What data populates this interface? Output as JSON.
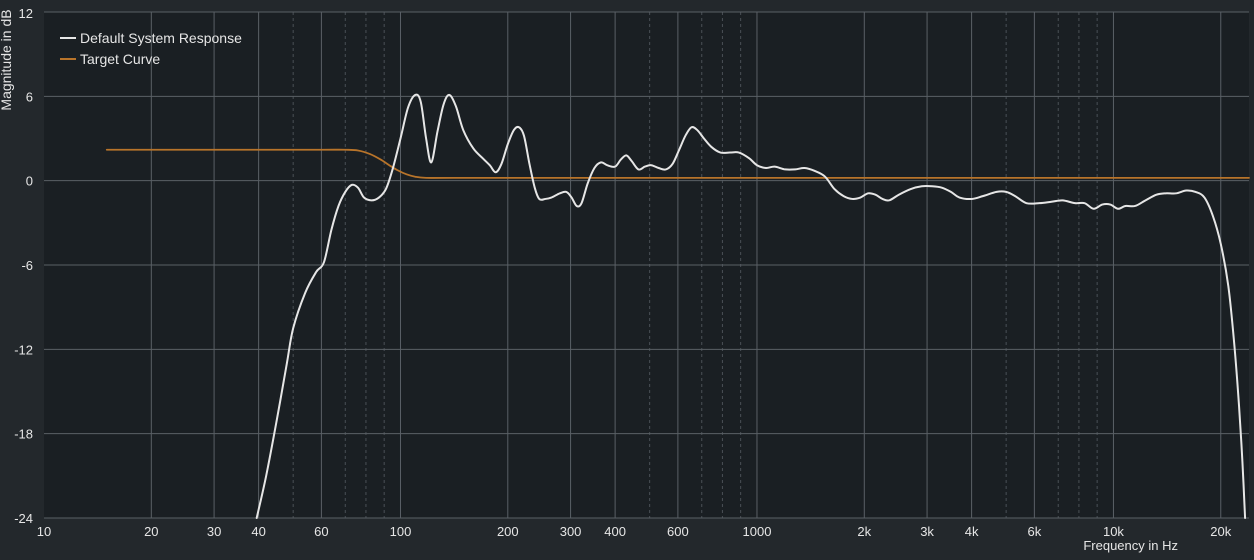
{
  "chart_data": {
    "type": "line",
    "xlabel": "Frequency in Hz",
    "ylabel": "Magnitude in dB",
    "x_scale": "log",
    "xlim": [
      10,
      24000
    ],
    "ylim": [
      -24,
      12
    ],
    "grid": true,
    "legend_position": "top-left",
    "x_ticks": [
      {
        "value": 10,
        "label": "10"
      },
      {
        "value": 20,
        "label": "20"
      },
      {
        "value": 30,
        "label": "30"
      },
      {
        "value": 40,
        "label": "40"
      },
      {
        "value": 60,
        "label": "60"
      },
      {
        "value": 100,
        "label": "100"
      },
      {
        "value": 200,
        "label": "200"
      },
      {
        "value": 300,
        "label": "300"
      },
      {
        "value": 400,
        "label": "400"
      },
      {
        "value": 600,
        "label": "600"
      },
      {
        "value": 1000,
        "label": "1000"
      },
      {
        "value": 2000,
        "label": "2k"
      },
      {
        "value": 3000,
        "label": "3k"
      },
      {
        "value": 4000,
        "label": "4k"
      },
      {
        "value": 6000,
        "label": "6k"
      },
      {
        "value": 10000,
        "label": "10k"
      },
      {
        "value": 20000,
        "label": "20k"
      }
    ],
    "y_ticks": [
      {
        "value": 12,
        "label": "12"
      },
      {
        "value": 6,
        "label": "6"
      },
      {
        "value": 0,
        "label": "0"
      },
      {
        "value": -6,
        "label": "-6"
      },
      {
        "value": -12,
        "label": "-12"
      },
      {
        "value": -18,
        "label": "-18"
      },
      {
        "value": -24,
        "label": "-24"
      }
    ],
    "series": [
      {
        "name": "Default System Response",
        "color": "#e6e6e6",
        "points": [
          [
            39.5,
            -24
          ],
          [
            42,
            -21
          ],
          [
            45,
            -17
          ],
          [
            48,
            -13
          ],
          [
            50,
            -10.5
          ],
          [
            54,
            -8
          ],
          [
            58,
            -6.5
          ],
          [
            61,
            -5.8
          ],
          [
            64,
            -3.5
          ],
          [
            67,
            -1.8
          ],
          [
            70,
            -0.8
          ],
          [
            73,
            -0.3
          ],
          [
            76,
            -0.5
          ],
          [
            79,
            -1.2
          ],
          [
            83,
            -1.4
          ],
          [
            87,
            -1.2
          ],
          [
            91,
            -0.6
          ],
          [
            95,
            0.8
          ],
          [
            100,
            3
          ],
          [
            105,
            5.2
          ],
          [
            110,
            6.1
          ],
          [
            114,
            5.6
          ],
          [
            118,
            3
          ],
          [
            122,
            1.3
          ],
          [
            127,
            3.5
          ],
          [
            132,
            5.4
          ],
          [
            137,
            6.1
          ],
          [
            143,
            5.3
          ],
          [
            150,
            3.6
          ],
          [
            160,
            2.3
          ],
          [
            170,
            1.6
          ],
          [
            178,
            1.1
          ],
          [
            185,
            0.6
          ],
          [
            192,
            1.2
          ],
          [
            200,
            2.6
          ],
          [
            208,
            3.6
          ],
          [
            215,
            3.8
          ],
          [
            222,
            3.2
          ],
          [
            230,
            1.2
          ],
          [
            238,
            -0.5
          ],
          [
            245,
            -1.3
          ],
          [
            255,
            -1.3
          ],
          [
            265,
            -1.2
          ],
          [
            280,
            -0.9
          ],
          [
            292,
            -0.8
          ],
          [
            302,
            -1.2
          ],
          [
            312,
            -1.8
          ],
          [
            322,
            -1.6
          ],
          [
            335,
            -0.2
          ],
          [
            350,
            0.9
          ],
          [
            365,
            1.3
          ],
          [
            380,
            1.1
          ],
          [
            400,
            1
          ],
          [
            415,
            1.5
          ],
          [
            430,
            1.8
          ],
          [
            445,
            1.4
          ],
          [
            465,
            0.8
          ],
          [
            485,
            1
          ],
          [
            505,
            1.1
          ],
          [
            530,
            0.9
          ],
          [
            555,
            0.8
          ],
          [
            580,
            1.2
          ],
          [
            605,
            2.2
          ],
          [
            630,
            3.2
          ],
          [
            655,
            3.8
          ],
          [
            680,
            3.6
          ],
          [
            710,
            3
          ],
          [
            745,
            2.4
          ],
          [
            790,
            2
          ],
          [
            840,
            2
          ],
          [
            890,
            2
          ],
          [
            950,
            1.6
          ],
          [
            1000,
            1.1
          ],
          [
            1060,
            0.9
          ],
          [
            1120,
            1
          ],
          [
            1200,
            0.8
          ],
          [
            1280,
            0.8
          ],
          [
            1360,
            0.9
          ],
          [
            1450,
            0.7
          ],
          [
            1550,
            0.3
          ],
          [
            1650,
            -0.6
          ],
          [
            1750,
            -1.1
          ],
          [
            1850,
            -1.3
          ],
          [
            1950,
            -1.2
          ],
          [
            2050,
            -0.9
          ],
          [
            2150,
            -1
          ],
          [
            2250,
            -1.3
          ],
          [
            2350,
            -1.4
          ],
          [
            2500,
            -1
          ],
          [
            2700,
            -0.6
          ],
          [
            2900,
            -0.4
          ],
          [
            3100,
            -0.4
          ],
          [
            3300,
            -0.5
          ],
          [
            3500,
            -0.8
          ],
          [
            3700,
            -1.2
          ],
          [
            4000,
            -1.3
          ],
          [
            4300,
            -1.1
          ],
          [
            4700,
            -0.8
          ],
          [
            5000,
            -0.8
          ],
          [
            5300,
            -1.1
          ],
          [
            5700,
            -1.6
          ],
          [
            6200,
            -1.6
          ],
          [
            6700,
            -1.5
          ],
          [
            7200,
            -1.4
          ],
          [
            7800,
            -1.6
          ],
          [
            8300,
            -1.6
          ],
          [
            8800,
            -2
          ],
          [
            9300,
            -1.7
          ],
          [
            9800,
            -1.7
          ],
          [
            10300,
            -2
          ],
          [
            10800,
            -1.8
          ],
          [
            11500,
            -1.8
          ],
          [
            12300,
            -1.4
          ],
          [
            13200,
            -1
          ],
          [
            14000,
            -0.9
          ],
          [
            15000,
            -0.9
          ],
          [
            16000,
            -0.7
          ],
          [
            17000,
            -0.8
          ],
          [
            18000,
            -1.2
          ],
          [
            19000,
            -2.5
          ],
          [
            20000,
            -4.5
          ],
          [
            21000,
            -7.5
          ],
          [
            21800,
            -11.5
          ],
          [
            22500,
            -16
          ],
          [
            23000,
            -20
          ],
          [
            23400,
            -24
          ]
        ]
      },
      {
        "name": "Target Curve",
        "color": "#b8742a",
        "points": [
          [
            15,
            2.2
          ],
          [
            25,
            2.2
          ],
          [
            40,
            2.2
          ],
          [
            60,
            2.2
          ],
          [
            70,
            2.2
          ],
          [
            76,
            2.15
          ],
          [
            82,
            1.9
          ],
          [
            88,
            1.5
          ],
          [
            93,
            1.1
          ],
          [
            98,
            0.75
          ],
          [
            104,
            0.45
          ],
          [
            110,
            0.28
          ],
          [
            118,
            0.2
          ],
          [
            140,
            0.2
          ],
          [
            300,
            0.2
          ],
          [
            1000,
            0.2
          ],
          [
            5000,
            0.2
          ],
          [
            24000,
            0.2
          ]
        ]
      }
    ]
  }
}
